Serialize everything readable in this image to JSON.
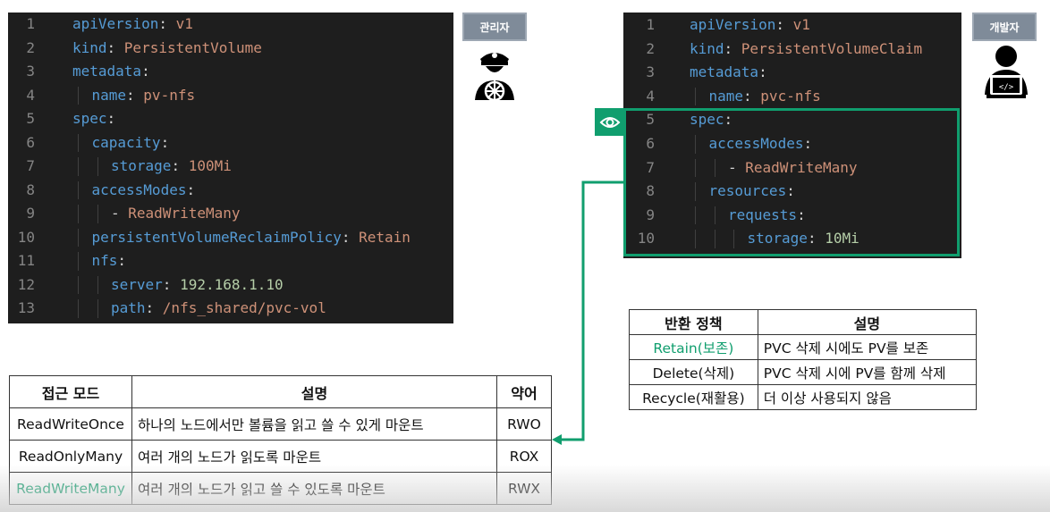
{
  "pv_editor": {
    "lines": [
      {
        "num": "1",
        "indent": 0,
        "key": "apiVersion",
        "sep": ": ",
        "val": "v1",
        "val_type": "s"
      },
      {
        "num": "2",
        "indent": 0,
        "key": "kind",
        "sep": ": ",
        "val": "PersistentVolume",
        "val_type": "s"
      },
      {
        "num": "3",
        "indent": 0,
        "key": "metadata",
        "sep": ":",
        "val": "",
        "val_type": "s"
      },
      {
        "num": "4",
        "indent": 1,
        "key": "name",
        "sep": ": ",
        "val": "pv-nfs",
        "val_type": "s"
      },
      {
        "num": "5",
        "indent": 0,
        "key": "spec",
        "sep": ":",
        "val": "",
        "val_type": "s"
      },
      {
        "num": "6",
        "indent": 1,
        "key": "capacity",
        "sep": ":",
        "val": "",
        "val_type": "s"
      },
      {
        "num": "7",
        "indent": 2,
        "key": "storage",
        "sep": ": ",
        "val": "100Mi",
        "val_type": "s"
      },
      {
        "num": "8",
        "indent": 1,
        "key": "accessModes",
        "sep": ":",
        "val": "",
        "val_type": "s"
      },
      {
        "num": "9",
        "indent": 2,
        "key": "",
        "sep": "- ",
        "val": "ReadWriteMany",
        "val_type": "s"
      },
      {
        "num": "10",
        "indent": 1,
        "key": "persistentVolumeReclaimPolicy",
        "sep": ": ",
        "val": "Retain",
        "val_type": "s"
      },
      {
        "num": "11",
        "indent": 1,
        "key": "nfs",
        "sep": ":",
        "val": "",
        "val_type": "s"
      },
      {
        "num": "12",
        "indent": 2,
        "key": "server",
        "sep": ": ",
        "val": "192.168.1.10",
        "val_type": "n"
      },
      {
        "num": "13",
        "indent": 2,
        "key": "path",
        "sep": ": ",
        "val": "/nfs_shared/pvc-vol",
        "val_type": "s"
      }
    ]
  },
  "pvc_editor": {
    "lines": [
      {
        "num": "1",
        "indent": 0,
        "key": "apiVersion",
        "sep": ": ",
        "val": "v1",
        "val_type": "s"
      },
      {
        "num": "2",
        "indent": 0,
        "key": "kind",
        "sep": ": ",
        "val": "PersistentVolumeClaim",
        "val_type": "s"
      },
      {
        "num": "3",
        "indent": 0,
        "key": "metadata",
        "sep": ":",
        "val": "",
        "val_type": "s"
      },
      {
        "num": "4",
        "indent": 1,
        "key": "name",
        "sep": ": ",
        "val": "pvc-nfs",
        "val_type": "s"
      },
      {
        "num": "5",
        "indent": 0,
        "key": "spec",
        "sep": ":",
        "val": "",
        "val_type": "s"
      },
      {
        "num": "6",
        "indent": 1,
        "key": "accessModes",
        "sep": ":",
        "val": "",
        "val_type": "s"
      },
      {
        "num": "7",
        "indent": 2,
        "key": "",
        "sep": "- ",
        "val": "ReadWriteMany",
        "val_type": "s"
      },
      {
        "num": "8",
        "indent": 1,
        "key": "resources",
        "sep": ":",
        "val": "",
        "val_type": "s"
      },
      {
        "num": "9",
        "indent": 2,
        "key": "requests",
        "sep": ":",
        "val": "",
        "val_type": "s"
      },
      {
        "num": "10",
        "indent": 3,
        "key": "storage",
        "sep": ": ",
        "val": "10Mi",
        "val_type": "n"
      }
    ]
  },
  "roles": {
    "admin_label": "관리자",
    "admin_icon": "ship-captain-icon",
    "developer_label": "개발자",
    "developer_icon": "developer-laptop-icon"
  },
  "highlight": {
    "color": "#109e6e",
    "icon": "eye-icon"
  },
  "policy_table": {
    "headers": [
      "반환 정책",
      "설명"
    ],
    "rows": [
      {
        "policy": "Retain(보존)",
        "desc": "PVC 삭제 시에도 PV를 보존",
        "highlight": true
      },
      {
        "policy": "Delete(삭제)",
        "desc": "PVC 삭제 시에 PV를 함께 삭제",
        "highlight": false
      },
      {
        "policy": "Recycle(재활용)",
        "desc": "더 이상 사용되지 않음",
        "highlight": false
      }
    ]
  },
  "access_table": {
    "headers": [
      "접근 모드",
      "설명",
      "약어"
    ],
    "rows": [
      {
        "mode": "ReadWriteOnce",
        "desc": "하나의 노드에서만 볼륨을 읽고 쓸 수 있게 마운트",
        "abbr": "RWO",
        "highlight": false
      },
      {
        "mode": "ReadOnlyMany",
        "desc": "여러 개의 노드가 읽도록 마운트",
        "abbr": "ROX",
        "highlight": false
      },
      {
        "mode": "ReadWriteMany",
        "desc": "여러 개의 노드가 읽고 쓸 수 있도록 마운트",
        "abbr": "RWX",
        "highlight": true
      }
    ]
  }
}
